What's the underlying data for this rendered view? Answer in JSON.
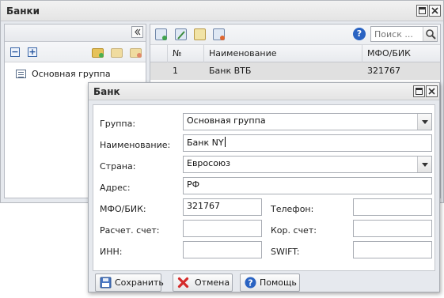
{
  "window": {
    "title": "Банки"
  },
  "left_panel": {
    "tree_items": [
      {
        "label": "Основная группа"
      }
    ]
  },
  "grid": {
    "search_placeholder": "Поиск ...",
    "columns": [
      "№",
      "Наименование",
      "МФО/БИК"
    ],
    "rows": [
      {
        "num": "1",
        "name": "Банк ВТБ",
        "mfo": "321767"
      }
    ]
  },
  "dialog": {
    "title": "Банк",
    "fields": {
      "group": {
        "label": "Группа:",
        "value": "Основная группа"
      },
      "name": {
        "label": "Наименование:",
        "value": "Банк NY"
      },
      "country": {
        "label": "Страна:",
        "value": "Евросоюз"
      },
      "address": {
        "label": "Адрес:",
        "value": "РФ"
      },
      "mfo": {
        "label": "МФО/БИК:",
        "value": "321767"
      },
      "phone": {
        "label": "Телефон:",
        "value": ""
      },
      "account": {
        "label": "Расчет. счет:",
        "value": ""
      },
      "corr": {
        "label": "Кор. счет:",
        "value": ""
      },
      "inn": {
        "label": "ИНН:",
        "value": ""
      },
      "swift": {
        "label": "SWIFT:",
        "value": ""
      }
    },
    "buttons": {
      "save": "Сохранить",
      "cancel": "Отмена",
      "help": "Помощь"
    }
  },
  "icons": {
    "window": [
      "maximize-icon",
      "close-icon"
    ],
    "left_toolbar": [
      "collapse-all-icon",
      "expand-all-icon",
      "add-folder-icon",
      "edit-folder-icon",
      "delete-folder-icon"
    ],
    "grid_toolbar": [
      "add-record-icon",
      "edit-record-icon",
      "copy-record-icon",
      "delete-record-icon",
      "help-icon",
      "search-icon"
    ]
  }
}
